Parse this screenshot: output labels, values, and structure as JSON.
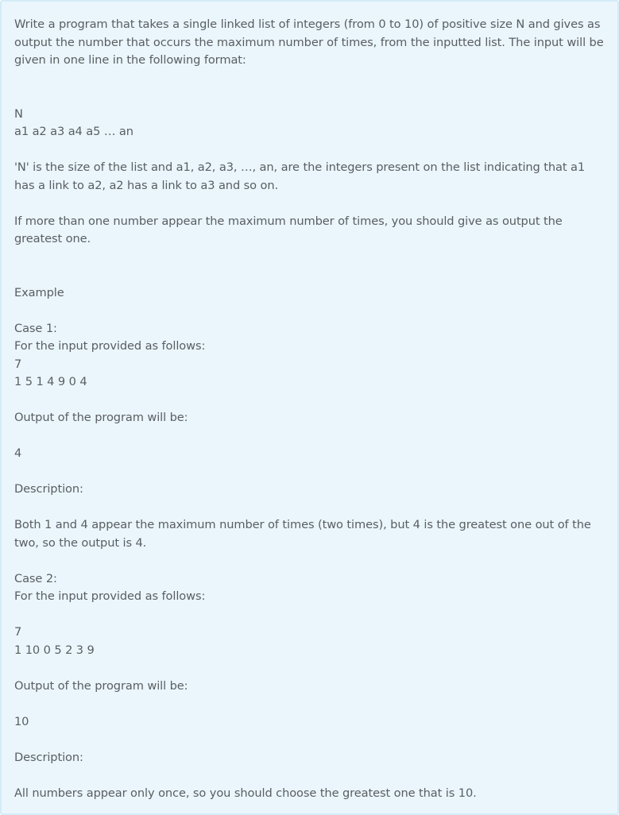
{
  "problem": {
    "intro": "Write a program that takes a single linked list of integers (from 0 to 10) of positive size N and gives as output the number that occurs the maximum number of times, from the inputted list. The input will be given in one line in the following format:",
    "format_line1": "N",
    "format_line2": "a1 a2 a3 a4 a5 … an",
    "explanation": "'N' is the size of the list and a1, a2, a3, …, an, are the integers present on the list indicating that a1 has a link to a2, a2 has a link to a3 and so on.",
    "tie_rule": "If more than one number appear the maximum number of times, you should give as output the greatest one.",
    "example_heading": "Example"
  },
  "case1": {
    "label": "Case 1:",
    "input_prompt": "For the input provided as follows:",
    "n": "7",
    "list": "1 5 1 4 9 0 4",
    "output_prompt": "Output of the program will be:",
    "output": "4",
    "description_label": "Description:",
    "description": "Both 1 and 4 appear the maximum number of times (two times), but 4 is the greatest one out of the two, so the output is 4."
  },
  "case2": {
    "label": "Case 2:",
    "input_prompt": "For the input provided as follows:",
    "n": "7",
    "list": "1 10 0 5 2 3 9",
    "output_prompt": "Output of the program will be:",
    "output": "10",
    "description_label": "Description:",
    "description": "All numbers appear only once, so you should choose the greatest one that is 10."
  }
}
